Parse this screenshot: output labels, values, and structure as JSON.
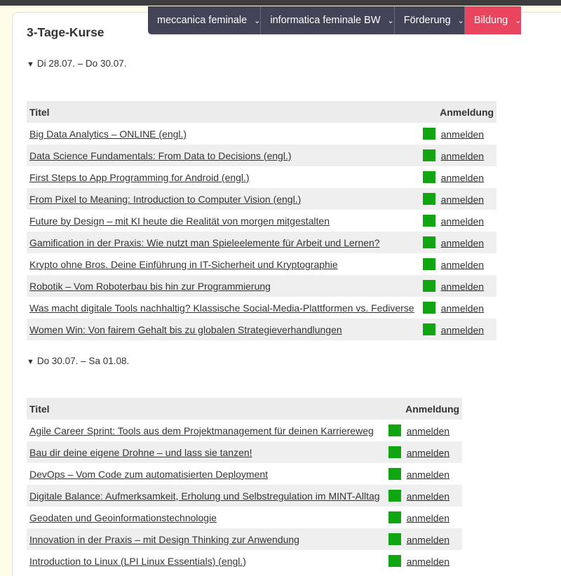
{
  "nav": [
    {
      "label": "meccanica feminale",
      "style": "dark"
    },
    {
      "label": "informatica feminale BW",
      "style": "dark"
    },
    {
      "label": "Förderung",
      "style": "dark"
    },
    {
      "label": "Bildung",
      "style": "pink"
    }
  ],
  "colors": {
    "accent_pink": "#e9455f",
    "nav_dark": "#434358",
    "status_green": "#11a511",
    "page_bg": "#fffde9"
  },
  "page_title": "3-Tage-Kurse",
  "sections": [
    {
      "summary": "Di 28.07. – Do 30.07.",
      "col_title": "Titel",
      "col_reg": "Anmeldung",
      "rows": [
        {
          "title": "Big Data Analytics – ONLINE (engl.)",
          "reg": "anmelden"
        },
        {
          "title": "Data Science Fundamentals: From Data to Decisions (engl.)",
          "reg": "anmelden"
        },
        {
          "title": "First Steps to App Programming for Android (engl.)",
          "reg": "anmelden"
        },
        {
          "title": "From Pixel to Meaning: Introduction to Computer Vision (engl.)",
          "reg": "anmelden"
        },
        {
          "title": "Future by Design – mit KI heute die Realität von morgen mitgestalten",
          "reg": "anmelden"
        },
        {
          "title": "Gamification in der Praxis: Wie nutzt man Spieleelemente für Arbeit und Lernen?",
          "reg": "anmelden"
        },
        {
          "title": "Krypto ohne Bros. Deine Einführung in IT-Sicherheit und Kryptographie",
          "reg": "anmelden"
        },
        {
          "title": "Robotik – Vom Roboterbau bis hin zur Programmierung",
          "reg": "anmelden"
        },
        {
          "title": "Was macht digitale Tools nachhaltig? Klassische Social-Media-Plattformen vs. Fediverse",
          "reg": "anmelden"
        },
        {
          "title": "Women Win: Von fairem Gehalt bis zu globalen Strategieverhandlungen",
          "reg": "anmelden"
        }
      ]
    },
    {
      "summary": "Do 30.07. – Sa 01.08.",
      "col_title": "Titel",
      "col_reg": "Anmeldung",
      "rows": [
        {
          "title": "Agile Career Sprint: Tools aus dem Projektmanagement für deinen Karriereweg",
          "reg": "anmelden"
        },
        {
          "title": "Bau dir deine eigene Drohne – und lass sie tanzen!",
          "reg": "anmelden"
        },
        {
          "title": "DevOps – Vom Code zum automatisierten Deployment",
          "reg": "anmelden"
        },
        {
          "title": "Digitale Balance: Aufmerksamkeit, Erholung und Selbstregulation im MINT-Alltag",
          "reg": "anmelden"
        },
        {
          "title": "Geodaten und Geoinformationstechnologie",
          "reg": "anmelden"
        },
        {
          "title": "Innovation in der Praxis – mit Design Thinking zur Anwendung",
          "reg": "anmelden"
        },
        {
          "title": "Introduction to Linux (LPI Linux Essentials) (engl.)",
          "reg": "anmelden"
        }
      ]
    }
  ]
}
